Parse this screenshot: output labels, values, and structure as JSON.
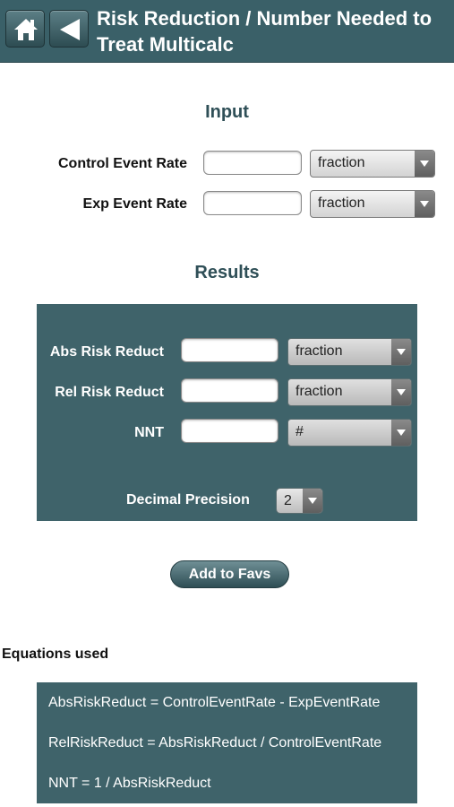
{
  "header": {
    "title": "Risk Reduction / Number Needed to Treat Multicalc",
    "home_icon": "home-icon",
    "back_icon": "back-arrow-icon"
  },
  "input": {
    "heading": "Input",
    "rows": [
      {
        "label": "Control Event Rate",
        "value": "",
        "unit": "fraction"
      },
      {
        "label": "Exp Event Rate",
        "value": "",
        "unit": "fraction"
      }
    ]
  },
  "results": {
    "heading": "Results",
    "rows": [
      {
        "label": "Abs Risk Reduct",
        "value": "",
        "unit": "fraction"
      },
      {
        "label": "Rel Risk Reduct",
        "value": "",
        "unit": "fraction"
      },
      {
        "label": "NNT",
        "value": "",
        "unit": "#"
      }
    ],
    "precision_label": "Decimal Precision",
    "precision_value": "2"
  },
  "actions": {
    "add_to_favs": "Add to Favs"
  },
  "equations": {
    "heading": "Equations used",
    "lines": [
      "AbsRiskReduct = ControlEventRate - ExpEventRate",
      "RelRiskReduct = AbsRiskReduct / ControlEventRate",
      "NNT = 1 / AbsRiskReduct"
    ]
  },
  "colors": {
    "header_bg": "#3a6068",
    "panel_bg": "#3f636a",
    "heading_text": "#2f4f57"
  }
}
